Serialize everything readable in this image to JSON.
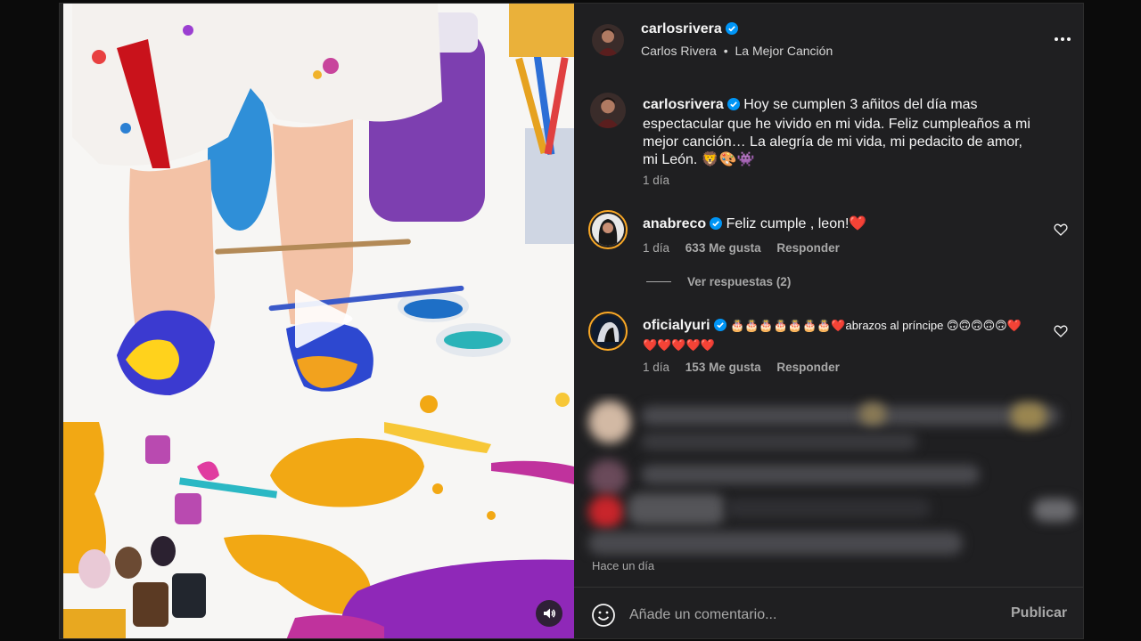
{
  "post": {
    "author_username": "carlosrivera",
    "author_fullname": "Carlos Rivera",
    "separator": "•",
    "audio_title": "La Mejor Canción"
  },
  "caption": {
    "username": "carlosrivera",
    "text": "Hoy se cumplen 3 añitos del día mas espectacular que he vivido en mi vida. Feliz cumpleaños a mi mejor canción… La alegría de mi vida, mi pedacito de amor, mi León. 🦁🎨👾",
    "age": "1 día"
  },
  "comments": [
    {
      "username": "anabreco",
      "text": "Feliz cumple , leon!❤️",
      "age": "1 día",
      "likes": "633 Me gusta",
      "reply_label": "Responder",
      "view_replies": "Ver respuestas (2)"
    },
    {
      "username": "oficialyuri",
      "text": "🎂🎂🎂🎂🎂🎂🎂❤️abrazos al príncipe 🙃🙃🙃🙃🙃❤️❤️❤️❤️❤️❤️",
      "age": "1 día",
      "likes": "153 Me gusta",
      "reply_label": "Responder"
    }
  ],
  "footer": {
    "time_ago": "Hace un día",
    "comment_placeholder": "Añade un comentario...",
    "publish_label": "Publicar"
  },
  "icons": {
    "verified": "verified-badge-icon",
    "more": "more-options-icon",
    "like": "heart-icon",
    "play": "play-icon",
    "mute": "speaker-icon",
    "emoji": "emoji-smiley-icon"
  },
  "colors": {
    "verified_blue": "#0095f6",
    "panel_bg": "#1f1f21",
    "muted_text": "#a8a8a8",
    "story_ring": "#f9a826"
  }
}
